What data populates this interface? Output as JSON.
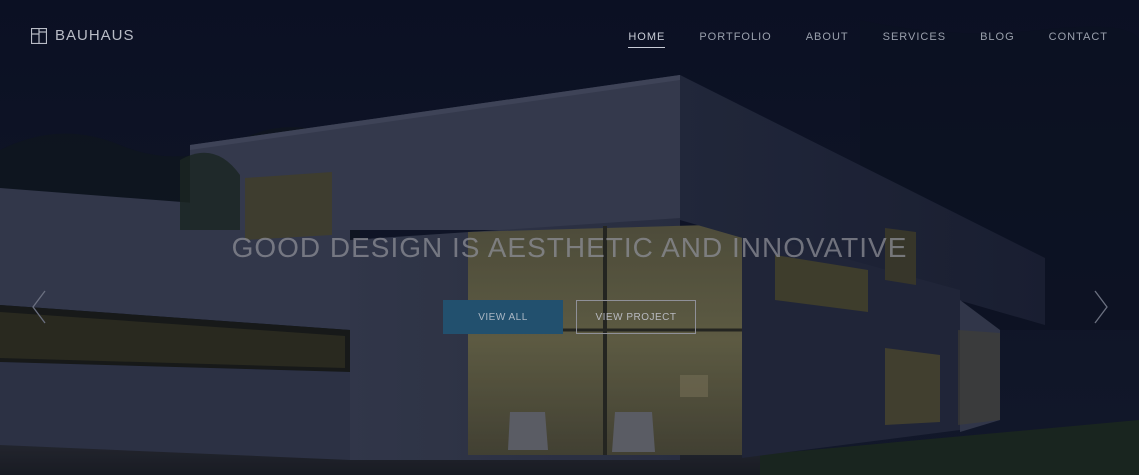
{
  "brand": {
    "name": "BAUHAUS",
    "icon": "bauhaus-logo-icon"
  },
  "nav": {
    "items": [
      {
        "label": "HOME",
        "active": true
      },
      {
        "label": "PORTFOLIO",
        "active": false
      },
      {
        "label": "ABOUT",
        "active": false
      },
      {
        "label": "SERVICES",
        "active": false
      },
      {
        "label": "BLOG",
        "active": false
      },
      {
        "label": "CONTACT",
        "active": false
      }
    ]
  },
  "hero": {
    "headline": "GOOD DESIGN IS AESTHETIC AND INNOVATIVE",
    "primary_button": "VIEW ALL",
    "secondary_button": "VIEW PROJECT",
    "prev_icon": "chevron-left-icon",
    "next_icon": "chevron-right-icon"
  },
  "colors": {
    "accent": "#22506e",
    "background": "#0b1020"
  }
}
